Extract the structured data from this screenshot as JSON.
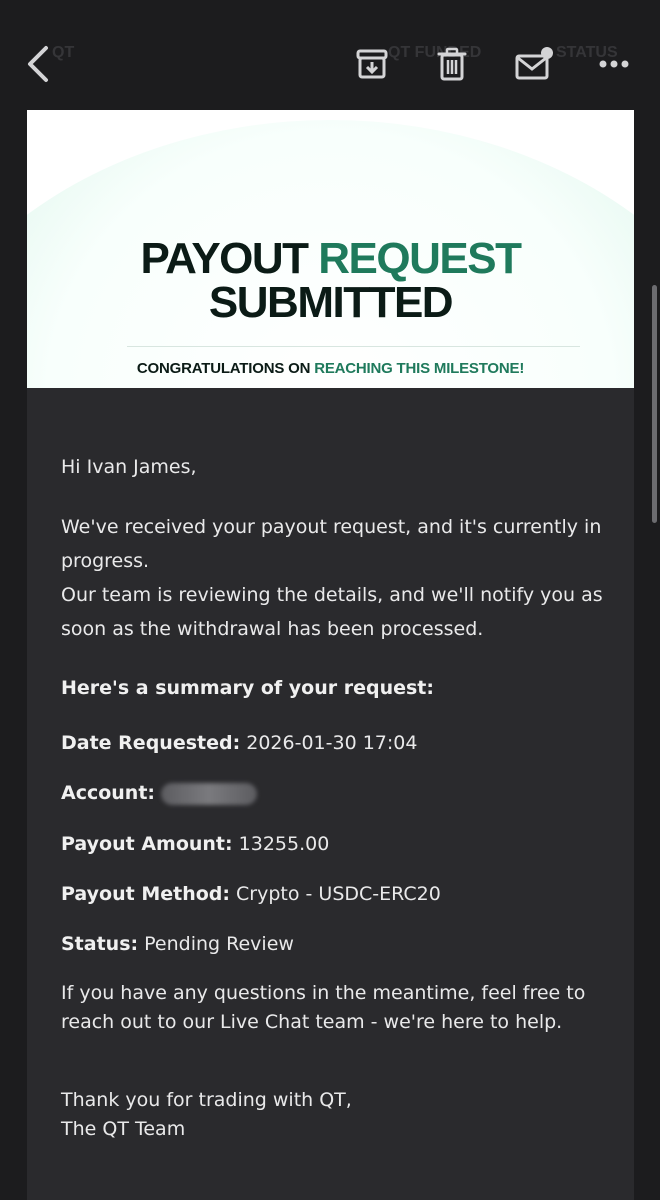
{
  "toolbar": {
    "back_icon": "chevron-left-icon",
    "ghost_left": "QT",
    "ghost_mid": "QT FUNDED",
    "ghost_right": "STATUS",
    "actions": [
      "archive-icon",
      "trash-icon",
      "mail-unread-icon",
      "more-icon"
    ]
  },
  "hero": {
    "title_part1": "PAYOUT ",
    "title_part2": "REQUEST",
    "title_line2": "SUBMITTED",
    "subtitle_part1": "CONGRATULATIONS ON ",
    "subtitle_part2": "REACHING THIS MILESTONE!",
    "accent_color": "#1f7a5c"
  },
  "email": {
    "greeting": "Hi Ivan James,",
    "intro_1": "We've received your payout request, and it's currently in progress.",
    "intro_2": "Our team is reviewing the details, and we'll notify you as soon as the withdrawal has been processed.",
    "summary_heading": "Here's a summary of your request:",
    "details": {
      "date_label": "Date Requested:",
      "date_value": "2026-01-30 17:04",
      "account_label": "Account:",
      "amount_label": "Payout Amount:",
      "amount_value": "13255.00",
      "method_label": "Payout Method:",
      "method_value": "Crypto - USDC-ERC20",
      "status_label": "Status:",
      "status_value": "Pending Review"
    },
    "closing": "If you have any questions in the meantime, feel free to reach out to our Live Chat team - we're here to help.",
    "signoff_1": "Thank you for trading with QT,",
    "signoff_2": "The QT Team"
  }
}
